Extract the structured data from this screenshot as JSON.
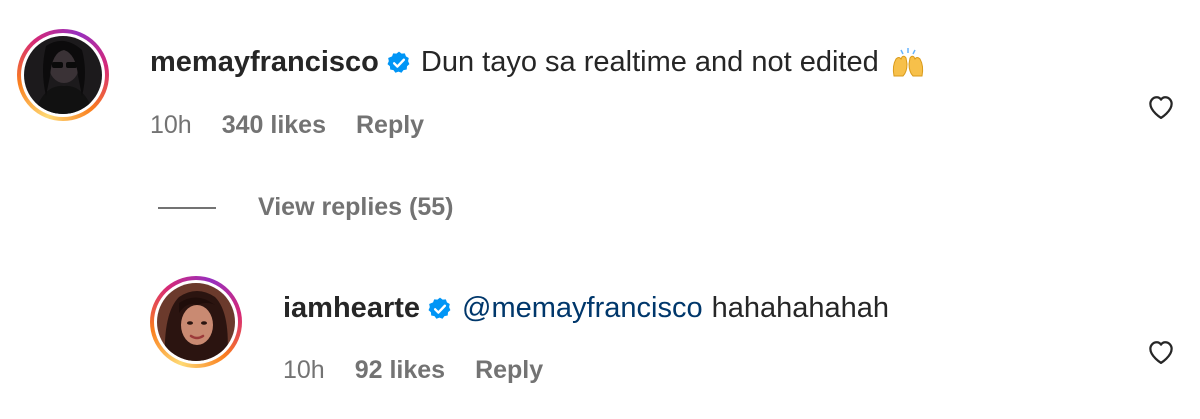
{
  "comments": [
    {
      "username": "memayfrancisco",
      "verified": true,
      "text": "Dun tayo sa realtime and not edited",
      "emoji": "raising-hands-emoji",
      "time": "10h",
      "likes": "340 likes",
      "reply_label": "Reply",
      "avatar_icon": "profile-avatar"
    },
    {
      "username": "iamhearte",
      "verified": true,
      "mention": "@memayfrancisco",
      "text": "hahahahahah",
      "time": "10h",
      "likes": "92 likes",
      "reply_label": "Reply",
      "avatar_icon": "profile-avatar"
    }
  ],
  "view_replies": {
    "label": "View replies (55)"
  },
  "colors": {
    "text": "#262626",
    "secondary": "#737373",
    "mention": "#00376b",
    "verified": "#0095f6"
  },
  "icons": {
    "like": "heart-outline-icon",
    "verified": "verified-badge-icon"
  }
}
